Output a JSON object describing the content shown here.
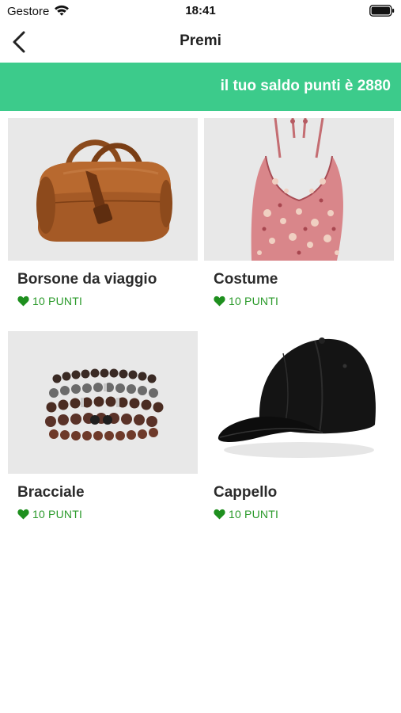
{
  "status_bar": {
    "carrier": "Gestore",
    "time": "18:41",
    "icons": [
      "wifi-icon",
      "battery-icon"
    ]
  },
  "nav": {
    "title": "Premi",
    "back_icon": "chevron-left-icon"
  },
  "balance": {
    "text": "il tuo saldo punti è 2880"
  },
  "colors": {
    "accent": "#3ccb8b",
    "points_green": "#2a9a2a",
    "image_bg": "#e8e8e8"
  },
  "products": [
    {
      "name": "Borsone da viaggio",
      "points": "10 PUNTI",
      "image": "travel-bag-image"
    },
    {
      "name": "Costume",
      "points": "10 PUNTI",
      "image": "swimsuit-image"
    },
    {
      "name": "Bracciale",
      "points": "10 PUNTI",
      "image": "bracelet-image"
    },
    {
      "name": "Cappello",
      "points": "10 PUNTI",
      "image": "cap-image"
    }
  ]
}
